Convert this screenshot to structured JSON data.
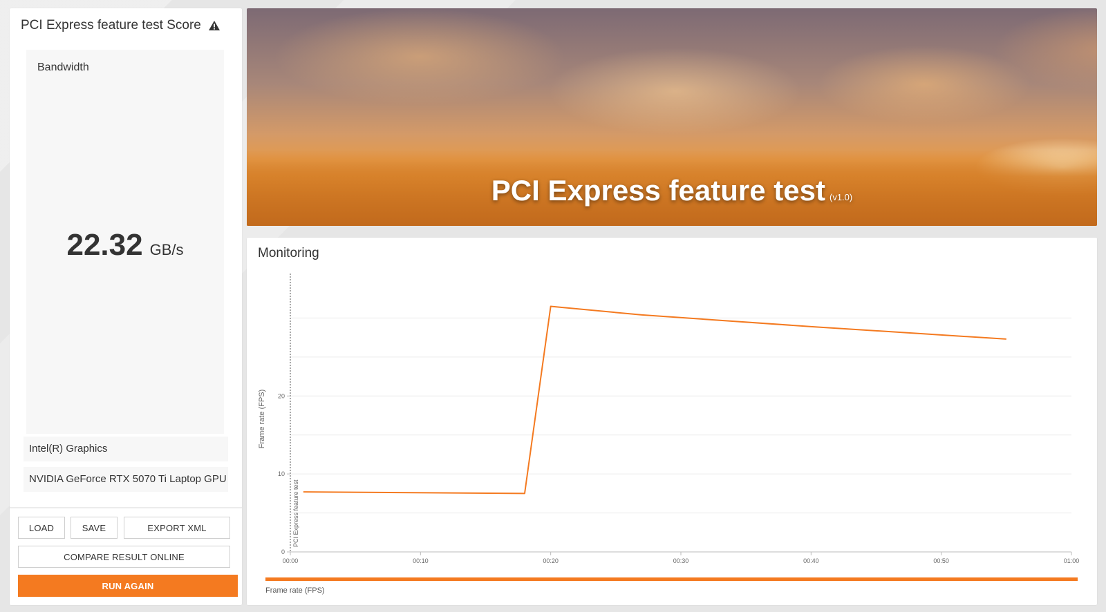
{
  "score_panel": {
    "title": "PCI Express feature test Score",
    "metric_label": "Bandwidth",
    "score_value": "22.32",
    "score_unit": "GB/s",
    "gpus": [
      "Intel(R) Graphics",
      "NVIDIA GeForce RTX 5070 Ti Laptop GPU"
    ],
    "buttons": {
      "load": "LOAD",
      "save": "SAVE",
      "export": "EXPORT XML",
      "compare": "COMPARE RESULT ONLINE",
      "run_again": "RUN AGAIN"
    }
  },
  "banner": {
    "title": "PCI Express feature test",
    "version": "(v1.0)"
  },
  "monitoring": {
    "title": "Monitoring",
    "legend_label": "Frame rate (FPS)",
    "accent_color": "#f47a20"
  },
  "chart_data": {
    "type": "line",
    "ylabel": "Frame rate (FPS)",
    "xlabel": "",
    "marker_label": "PCI Express feature test",
    "x_ticks": [
      "00:00",
      "00:10",
      "00:20",
      "00:30",
      "00:40",
      "00:50",
      "01:00"
    ],
    "y_ticks": [
      0,
      10,
      20
    ],
    "xlim": [
      0,
      60
    ],
    "ylim": [
      0,
      35
    ],
    "series": [
      {
        "name": "Frame rate (FPS)",
        "color": "#f47a20",
        "x": [
          1,
          18,
          20,
          27,
          40,
          55
        ],
        "y": [
          7.7,
          7.5,
          31.5,
          30.4,
          28.9,
          27.3
        ]
      }
    ],
    "grid": true
  }
}
